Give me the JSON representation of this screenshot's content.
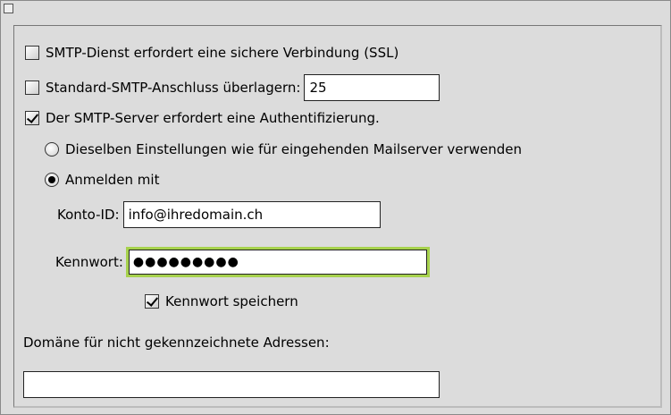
{
  "smtp_ssl": {
    "label": "SMTP-Dienst erfordert eine sichere Verbindung (SSL)",
    "checked": false
  },
  "port_override": {
    "label": "Standard-SMTP-Anschluss überlagern:",
    "value": "25",
    "checked": false
  },
  "auth_required": {
    "label": "Der SMTP-Server erfordert eine Authentifizierung.",
    "checked": true
  },
  "auth_mode": {
    "same_settings_label": "Dieselben Einstellungen wie für eingehenden Mailserver verwenden",
    "login_with_label": "Anmelden mit",
    "selected": "login_with"
  },
  "account": {
    "label": "Konto-ID:",
    "value": "info@ihredomain.ch"
  },
  "password": {
    "label": "Kennwort:",
    "masked_value": "●●●●●●●●●",
    "save_label": "Kennwort speichern",
    "save_checked": true
  },
  "domain": {
    "label": "Domäne für nicht gekennzeichnete Adressen:",
    "value": ""
  }
}
